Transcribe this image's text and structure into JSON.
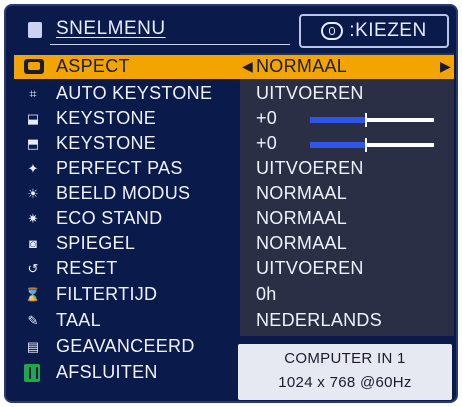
{
  "header": {
    "title": "SNELMENU",
    "right_label": ":KIEZEN"
  },
  "items": [
    {
      "label": "ASPECT",
      "value": "NORMAAL",
      "icon": "aspect-icon",
      "selected": true
    },
    {
      "label": "AUTO KEYSTONE",
      "value": "UITVOEREN",
      "icon": "auto-keystone-icon"
    },
    {
      "label": "KEYSTONE",
      "value": "+0",
      "icon": "keystone-v-icon",
      "bar": 0.45
    },
    {
      "label": "KEYSTONE",
      "value": "+0",
      "icon": "keystone-h-icon",
      "bar": 0.45
    },
    {
      "label": "PERFECT PAS",
      "value": "UITVOEREN",
      "icon": "perfect-pas-icon"
    },
    {
      "label": "BEELD MODUS",
      "value": "NORMAAL",
      "icon": "beeld-modus-icon"
    },
    {
      "label": "ECO STAND",
      "value": "NORMAAL",
      "icon": "eco-stand-icon"
    },
    {
      "label": "SPIEGEL",
      "value": "NORMAAL",
      "icon": "spiegel-icon"
    },
    {
      "label": "RESET",
      "value": "UITVOEREN",
      "icon": "reset-icon"
    },
    {
      "label": "FILTERTIJD",
      "value": "0h",
      "icon": "filter-icon"
    },
    {
      "label": "TAAL",
      "value": "NEDERLANDS",
      "icon": "taal-icon"
    },
    {
      "label": "GEAVANCEERD",
      "icon": "geavanceerd-icon"
    },
    {
      "label": "AFSLUITEN",
      "icon": "exit-icon"
    }
  ],
  "info": {
    "line1": "COMPUTER IN 1",
    "line2": "1024 x 768 @60Hz"
  },
  "colors": {
    "background": "#0a1a4a",
    "highlight": "#f2a400",
    "bar": "#2f56e8"
  }
}
